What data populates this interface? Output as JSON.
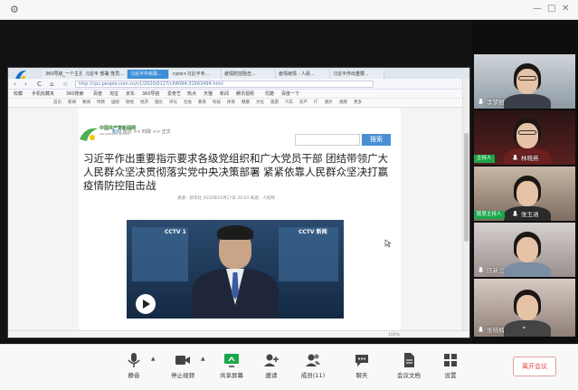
{
  "colors": {
    "main_bg": "#121212",
    "toolbar_bg": "#f8f8f8",
    "leave_red": "#e0453a",
    "host_green": "#1aa64a",
    "search_blue": "#4a8ed6"
  },
  "topbar": {
    "settings_icon": "gear-icon",
    "window_controls": [
      "—",
      "□",
      "✕"
    ]
  },
  "browser": {
    "tabs": [
      "360导航_一个主页...",
      "习近平 部署 党员...",
      "习近平中央政...",
      "<pre>习近平专...",
      "疫情防控阻击...",
      "疫情疫情 - 人民...",
      "习近平作出重要..."
    ],
    "nav_buttons": [
      "‹",
      "›",
      "C",
      "⌂",
      "☆"
    ],
    "url": "http://cpc.people.com.cn/n1/2020/0127/c64094-31563494.html",
    "bookmarks": [
      "收藏",
      "手机收藏夹",
      "360搜索",
      "百度",
      "淘宝",
      "京东",
      "360导航",
      "爱奇艺",
      "热点",
      "天猫",
      "新闻",
      "腾讯视频",
      "优酷",
      "百度一下"
    ],
    "site_nav": [
      "首页",
      "新闻",
      "要闻",
      "时政",
      "国际",
      "财经",
      "经济",
      "理论",
      "评论",
      "社会",
      "教育",
      "科技",
      "体育",
      "健康",
      "文化",
      "旅游",
      "汽车",
      "房产",
      "IT",
      "图片",
      "视频",
      "更多"
    ],
    "breadcrumb_lead": "新闻",
    "breadcrumb_rest": "首页 >> 时政 >> 正文",
    "site_name": "中国共产党新闻网",
    "site_domain": "cpc.people.com.cn",
    "search_button": "搜索",
    "article_title": "习近平作出重要指示要求各级党组织和广大党员干部 团结带领广大人民群众坚决贯彻落实党中央决策部署 紧紧依靠人民群众坚决打赢疫情防控阻击战",
    "article_meta": "来源：新华社  2020年01月27日 20:03  来源：人民网",
    "video_logo_left": "CCTV 1",
    "video_logo_right": "CCTV 新闻",
    "status_text": "100%"
  },
  "participants": [
    {
      "name": "李梦丽",
      "role": ""
    },
    {
      "name": "林晓燕",
      "role": "主持人"
    },
    {
      "name": "张玉涵",
      "role": "联席主持人"
    },
    {
      "name": "陈新兰",
      "role": ""
    },
    {
      "name": "张晓楠",
      "role": ""
    }
  ],
  "toolbar": {
    "mute": "静音",
    "stop_video": "停止视频",
    "share_screen": "共享屏幕",
    "invite": "邀请",
    "members": "成员(11)",
    "chat": "聊天",
    "documents": "会议文档",
    "settings": "设置",
    "leave": "离开会议"
  }
}
